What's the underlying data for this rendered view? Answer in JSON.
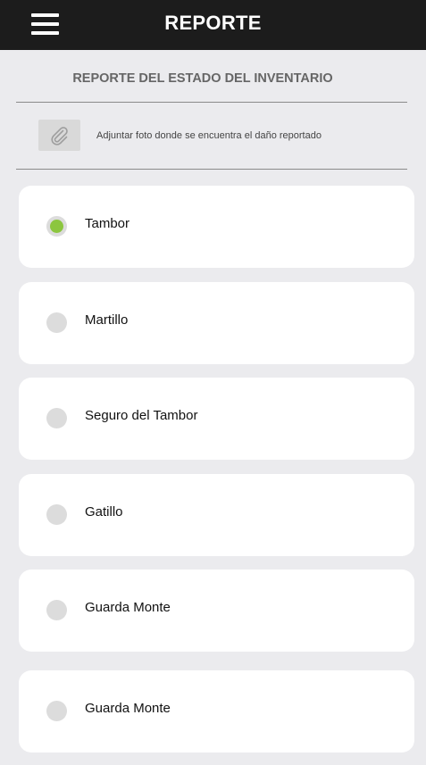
{
  "header": {
    "title": "REPORTE"
  },
  "report": {
    "section_title": "REPORTE DEL ESTADO DEL INVENTARIO",
    "attach_label": "Adjuntar foto donde se encuentra el daño reportado"
  },
  "items": [
    {
      "label": "Tambor",
      "selected": true
    },
    {
      "label": "Martillo",
      "selected": false
    },
    {
      "label": "Seguro del Tambor",
      "selected": false
    },
    {
      "label": "Gatillo",
      "selected": false
    },
    {
      "label": "Guarda Monte",
      "selected": false
    },
    {
      "label": "Guarda Monte",
      "selected": false
    }
  ],
  "icons": {
    "menu": "hamburger-menu-icon",
    "attach": "paperclip-icon"
  },
  "colors": {
    "header_bg": "#1c1c1c",
    "page_bg": "#ebebee",
    "selected_radio": "#8cc63f",
    "unselected_radio": "#dcdcdc"
  }
}
